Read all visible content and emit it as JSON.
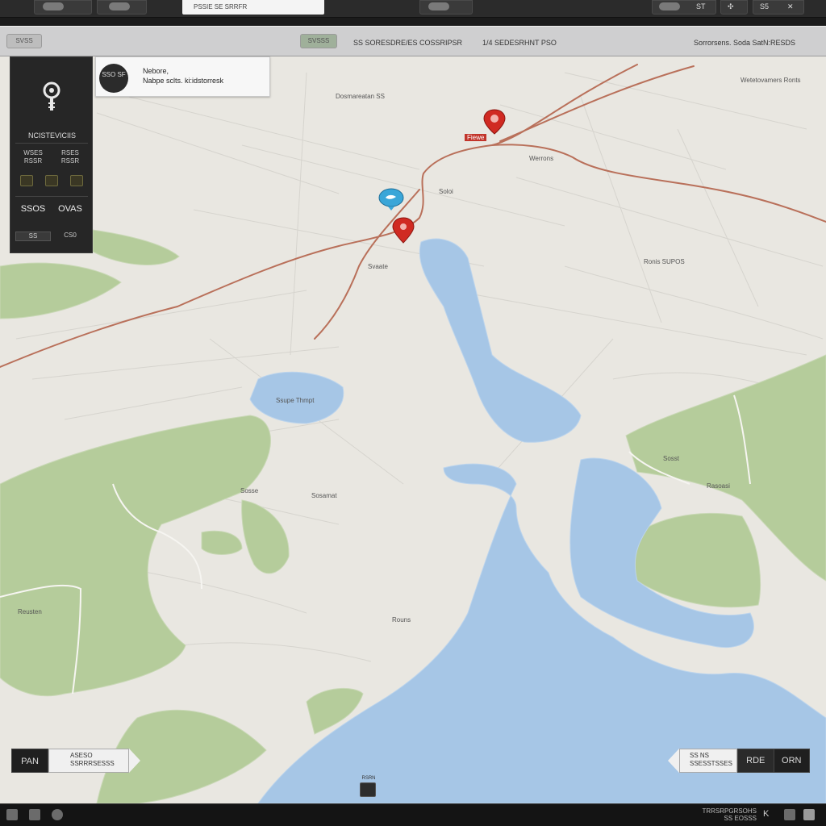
{
  "topbar": {
    "search_placeholder": "PSSIE SE SRRFR",
    "right_labels": [
      "ST",
      "S5"
    ],
    "colors": {
      "bg": "#2b2b2b"
    }
  },
  "toolbar": {
    "left_pill": "SVSS",
    "mid_pill": "SVSSS",
    "item1": "SS SORESDRE/ES COSSRIPSR",
    "item2": "1/4 SEDESRHNT PSO",
    "item3": "Sorrorsens. Soda SatN:RESDS"
  },
  "sidebar": {
    "title": "NCISTEVICIIS",
    "row1_left": "WSES RSSR",
    "row1_right": "RSES RSSR",
    "row3_left": "SSOS",
    "row3_right": "OVAS",
    "row4_left": "SS",
    "row4_right": "CS0",
    "icon": "map-pin-icon"
  },
  "info_card": {
    "badge": "SSO SF",
    "title": "Nebore,",
    "subtitle": "Nabpe sclts. ki:idstorresk"
  },
  "map_labels": {
    "top_center": "Dosmareatan SS",
    "top_right": "Wetetovamers Ronts",
    "east": "Werrons",
    "marker_red_top": "Fiewe",
    "south_lake": "Svaate",
    "near_blue": "Soloi",
    "right_mid": "Ronis SUPOS",
    "lake_west": "Ssupe Thmpt",
    "east_green": "Sosst",
    "east_green2": "Rasoasi",
    "center_small": "Sosamat",
    "west_green": "Sosse",
    "southwest": "Reusten",
    "lower_center": "Rouns"
  },
  "bottom_left": {
    "dark": "PAN",
    "line1": "ASESO",
    "line2": "SSRRRSESSS"
  },
  "bottom_right": {
    "line1": "SS NS",
    "line2": "SSESSTSSES",
    "seg1": "RDE",
    "seg2": "ORN"
  },
  "locate": {
    "label": "RSRN"
  },
  "taskbar": {
    "line1": "TRRSRPGRSOHS",
    "line2": "SS EOSSS",
    "clock": "K"
  },
  "colors": {
    "land": "#e9e7e1",
    "water": "#a6c6e6",
    "green": "#b5cc9b",
    "route": "#b9705a",
    "marker_red": "#d02a22",
    "marker_blue": "#3aa6d8"
  }
}
